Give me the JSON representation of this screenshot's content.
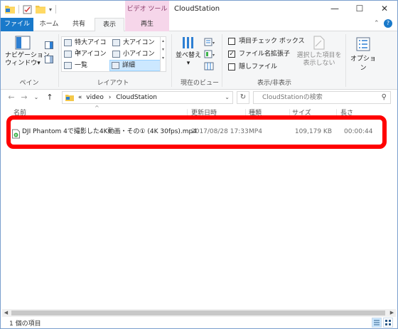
{
  "titlebar": {
    "context_tab": "ビデオ ツール",
    "title": "CloudStation",
    "minimize": "—",
    "maximize": "☐",
    "close": "✕"
  },
  "tabs": {
    "file": "ファイル",
    "home": "ホーム",
    "share": "共有",
    "view": "表示",
    "play": "再生"
  },
  "ribbon": {
    "pane": {
      "button_label": "ナビゲーション\nウィンドウ▾",
      "group_label": "ペイン"
    },
    "layout": {
      "items": [
        "特大アイコン",
        "大アイコン",
        "中アイコン",
        "小アイコン",
        "一覧",
        "詳細"
      ],
      "selected": "詳細",
      "group_label": "レイアウト"
    },
    "current_view": {
      "sort_label": "並べ替え\n▾",
      "group_label": "現在のビュー"
    },
    "show_hide": {
      "item_checkboxes": "項目チェック ボックス",
      "file_extensions": "ファイル名拡張子",
      "hidden_items": "隠しファイル",
      "hide_selected": "選択した項目を\n表示しない",
      "group_label": "表示/非表示"
    },
    "options": {
      "label": "オプション"
    }
  },
  "navigation": {
    "back": "←",
    "forward": "→",
    "recent": "⌄",
    "up": "↑",
    "path_prefix": "«",
    "path": [
      "video",
      "CloudStation"
    ],
    "path_separator": "›",
    "dropdown": "⌄",
    "refresh": "↻",
    "search_placeholder": "CloudStationの検索",
    "search_icon": "⚲"
  },
  "columns": {
    "sort_glyph": "^",
    "name": "名前",
    "date": "更新日時",
    "type": "種類",
    "size": "サイズ",
    "length": "長さ"
  },
  "files": [
    {
      "name": "DJI Phantom 4で撮影した4K動画・その① (4K 30fps).mp4",
      "date": "2017/08/28 17:33",
      "type": "MP4",
      "size": "109,179 KB",
      "length": "00:00:44"
    }
  ],
  "scrollbar": {
    "left_arrow": "◀",
    "right_arrow": "▶"
  },
  "status": {
    "item_count": "1 個の項目"
  },
  "colors": {
    "file_tab": "#1979ca",
    "context_tab": "#f6d6ea",
    "highlight": "#ff0000",
    "selected_layout": "#cce8ff"
  }
}
